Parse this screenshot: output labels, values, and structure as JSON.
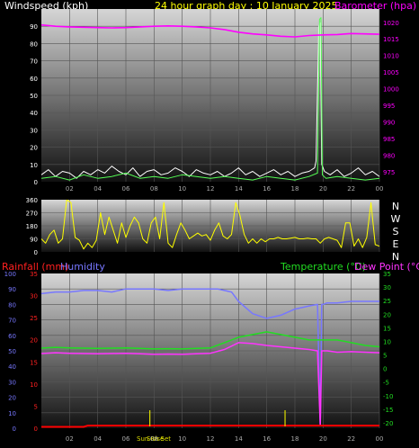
{
  "header": {
    "left_title": "Windspeed (kph)",
    "center_title": "24 hour graph day : 10 January 2025",
    "right_title": "Barometer (hpa)"
  },
  "colors": {
    "background": "#000000",
    "wind_axis": "#ffffff",
    "wind_speed": "#ffffff",
    "wind_gust": "#55ff55",
    "barometer": "#ff00ff",
    "direction": "#ffff00",
    "rain_axis": "#ff2020",
    "humidity": "#7777ff",
    "temperature": "#22dd22",
    "dew_point": "#ff33ff",
    "rain": "#ff0000",
    "sun_marker": "#dddd00",
    "axis_time": "#aaaaaa"
  },
  "chart_data": [
    {
      "id": "wind_baro",
      "type": "line",
      "title": "24 hour graph day : 10 January 2025",
      "x_ticks": [
        "02",
        "04",
        "06",
        "08",
        "10",
        "12",
        "14",
        "16",
        "18",
        "20",
        "22",
        "00"
      ],
      "xlim": [
        0,
        24
      ],
      "left_axis": {
        "label": "Windspeed (kph)",
        "ylim": [
          0,
          100
        ],
        "ticks": [
          "0",
          "10",
          "20",
          "30",
          "40",
          "50",
          "60",
          "70",
          "80",
          "90"
        ]
      },
      "right_axis": {
        "label": "Barometer (hpa)",
        "ylim": [
          972,
          1024
        ],
        "ticks": [
          "975",
          "980",
          "985",
          "990",
          "995",
          "1000",
          "1005",
          "1010",
          "1015",
          "1020"
        ]
      },
      "series": [
        {
          "key": "wind_speed",
          "axis": "left",
          "x": [
            0,
            0.5,
            1,
            1.5,
            2,
            2.5,
            3,
            3.5,
            4,
            4.5,
            5,
            5.5,
            6,
            6.5,
            7,
            7.5,
            8,
            8.5,
            9,
            9.5,
            10,
            10.5,
            11,
            11.5,
            12,
            12.5,
            13,
            13.5,
            14,
            14.5,
            15,
            15.5,
            16,
            16.5,
            17,
            17.5,
            18,
            18.5,
            19,
            19.4,
            19.5,
            19.7,
            19.8,
            19.9,
            20.1,
            20.5,
            21,
            21.5,
            22,
            22.5,
            23,
            23.5,
            24
          ],
          "y": [
            4,
            7,
            3,
            6,
            5,
            2,
            6,
            4,
            7,
            5,
            9,
            6,
            4,
            8,
            3,
            6,
            7,
            4,
            5,
            8,
            6,
            3,
            7,
            5,
            4,
            6,
            3,
            5,
            8,
            4,
            6,
            3,
            5,
            7,
            4,
            6,
            3,
            5,
            6,
            8,
            12,
            90,
            92,
            10,
            6,
            4,
            7,
            3,
            5,
            8,
            4,
            6,
            3
          ]
        },
        {
          "key": "wind_gust",
          "axis": "left",
          "x": [
            0,
            1,
            2,
            3,
            4,
            5,
            6,
            7,
            8,
            9,
            10,
            11,
            12,
            13,
            14,
            15,
            16,
            17,
            18,
            19,
            19.6,
            19.75,
            19.85,
            19.95,
            20.2,
            21,
            22,
            23,
            24
          ],
          "y": [
            2,
            3,
            1,
            4,
            2,
            3,
            5,
            2,
            3,
            2,
            4,
            3,
            2,
            3,
            2,
            1,
            3,
            2,
            1,
            3,
            5,
            94,
            95,
            4,
            2,
            3,
            2,
            1,
            2
          ]
        },
        {
          "key": "barometer",
          "axis": "right",
          "x": [
            0,
            1,
            2,
            3,
            4,
            5,
            6,
            7,
            8,
            9,
            10,
            11,
            12,
            13,
            14,
            15,
            16,
            17,
            18,
            19,
            20,
            21,
            22,
            23,
            24
          ],
          "y": [
            1019.2,
            1018.8,
            1018.6,
            1018.5,
            1018.4,
            1018.3,
            1018.4,
            1018.6,
            1018.8,
            1018.9,
            1018.8,
            1018.6,
            1018.3,
            1017.8,
            1017.0,
            1016.5,
            1016.2,
            1015.8,
            1015.6,
            1016.0,
            1016.2,
            1016.3,
            1016.6,
            1016.5,
            1016.4
          ]
        }
      ]
    },
    {
      "id": "wind_direction",
      "type": "line",
      "x_ticks": [],
      "xlim": [
        0,
        24
      ],
      "left_axis": {
        "ylim": [
          0,
          360
        ],
        "ticks": [
          "0",
          "90",
          "180",
          "270",
          "360"
        ]
      },
      "right_labels": [
        "N",
        "W",
        "S",
        "E",
        "N"
      ],
      "series": [
        {
          "key": "direction",
          "x": [
            0,
            0.3,
            0.6,
            0.9,
            1.2,
            1.5,
            1.8,
            2.1,
            2.4,
            2.7,
            3.0,
            3.3,
            3.6,
            3.9,
            4.2,
            4.5,
            4.8,
            5.1,
            5.4,
            5.7,
            6.0,
            6.3,
            6.6,
            6.9,
            7.2,
            7.5,
            7.8,
            8.1,
            8.4,
            8.7,
            9.0,
            9.3,
            9.6,
            9.9,
            10.2,
            10.5,
            10.8,
            11.1,
            11.4,
            11.7,
            12.0,
            12.3,
            12.6,
            12.9,
            13.2,
            13.5,
            13.8,
            14.1,
            14.4,
            14.7,
            15.0,
            15.3,
            15.6,
            15.9,
            16.2,
            16.5,
            16.8,
            17.1,
            17.4,
            17.7,
            18.0,
            18.3,
            18.6,
            18.9,
            19.2,
            19.5,
            19.8,
            20.1,
            20.4,
            20.7,
            21.0,
            21.3,
            21.6,
            21.9,
            22.2,
            22.5,
            22.8,
            23.1,
            23.4,
            23.7,
            24.0
          ],
          "y": [
            90,
            60,
            120,
            150,
            60,
            90,
            360,
            340,
            100,
            80,
            20,
            60,
            30,
            80,
            270,
            120,
            240,
            150,
            60,
            200,
            100,
            180,
            240,
            200,
            90,
            60,
            200,
            240,
            90,
            340,
            60,
            30,
            120,
            200,
            150,
            90,
            110,
            130,
            110,
            120,
            80,
            150,
            200,
            110,
            90,
            120,
            340,
            250,
            120,
            60,
            90,
            60,
            90,
            70,
            90,
            90,
            100,
            90,
            90,
            95,
            100,
            90,
            90,
            95,
            90,
            90,
            60,
            90,
            100,
            90,
            80,
            30,
            200,
            200,
            40,
            90,
            30,
            100,
            340,
            50,
            40
          ]
        }
      ]
    },
    {
      "id": "temp_rain_hum",
      "type": "line",
      "x_ticks": [
        "02",
        "04",
        "06",
        "08",
        "10",
        "12",
        "14",
        "16",
        "18",
        "20",
        "22",
        "00"
      ],
      "xlim": [
        0,
        24
      ],
      "humidity_axis": {
        "label": "Humidity",
        "ylim": [
          0,
          100
        ],
        "ticks": [
          "0",
          "10",
          "20",
          "30",
          "40",
          "50",
          "60",
          "70",
          "80",
          "90",
          "100"
        ]
      },
      "rain_axis": {
        "label": "Rainfall (mm)",
        "ylim": [
          0,
          35
        ],
        "ticks": [
          "0",
          "5",
          "10",
          "15",
          "20",
          "25",
          "30",
          "35"
        ]
      },
      "temp_axis": {
        "label": "Temperature (°C)",
        "ylim": [
          -22,
          35
        ],
        "ticks": [
          "-20",
          "-15",
          "-10",
          "-5",
          "0",
          "5",
          "10",
          "15",
          "20",
          "25",
          "30",
          "35"
        ]
      },
      "dew_label": "Dew Point (°C)",
      "sun_markers": [
        {
          "label": "Sun Rise",
          "x": 7.7
        },
        {
          "label": "Sun Set",
          "x": 17.3
        }
      ],
      "series": [
        {
          "key": "humidity",
          "axis": "humidity",
          "x": [
            0,
            1,
            2,
            3,
            4,
            5,
            6,
            7,
            8,
            9,
            10,
            11,
            12,
            12.5,
            13,
            13.5,
            14,
            15,
            16,
            17,
            18,
            19,
            19.6,
            19.8,
            19.9,
            20.0,
            20.3,
            21,
            22,
            23,
            24
          ],
          "y": [
            87,
            88,
            88,
            89,
            89,
            88,
            90,
            90,
            90,
            89,
            90,
            90,
            90,
            90,
            89,
            88,
            82,
            74,
            71,
            73,
            77,
            79,
            80,
            2,
            80,
            80,
            81,
            81,
            82,
            82,
            82
          ]
        },
        {
          "key": "temperature",
          "axis": "temp",
          "x": [
            0,
            1,
            2,
            3,
            4,
            5,
            6,
            7,
            8,
            9,
            10,
            11,
            12,
            13,
            14,
            15,
            16,
            17,
            18,
            19,
            20,
            21,
            22,
            23,
            24
          ],
          "y": [
            7.5,
            7.8,
            7.6,
            7.5,
            7.4,
            7.5,
            7.6,
            7.4,
            7.2,
            7.3,
            7.2,
            7.4,
            7.6,
            9.5,
            11.5,
            12.5,
            13.5,
            12.5,
            11.5,
            10.5,
            10.5,
            10.5,
            9.5,
            8.5,
            8.0
          ]
        },
        {
          "key": "dew_point",
          "axis": "temp",
          "x": [
            0,
            1,
            2,
            3,
            4,
            5,
            6,
            7,
            8,
            9,
            10,
            11,
            12,
            13,
            14,
            15,
            16,
            17,
            18,
            19,
            19.6,
            19.8,
            19.9,
            20.0,
            20.3,
            21,
            22,
            23,
            24
          ],
          "y": [
            5.5,
            5.8,
            5.6,
            5.5,
            5.4,
            5.5,
            5.6,
            5.4,
            5.2,
            5.3,
            5.2,
            5.4,
            5.6,
            7.0,
            9.5,
            9.2,
            8.5,
            8.0,
            7.5,
            7.0,
            6.5,
            -21,
            6.5,
            6.5,
            6.5,
            6.0,
            6.2,
            6.0,
            5.8
          ]
        },
        {
          "key": "rain",
          "axis": "rain",
          "x": [
            0,
            3,
            3.3,
            6,
            12,
            18,
            24
          ],
          "y": [
            0.3,
            0.3,
            0.6,
            0.6,
            0.6,
            0.6,
            0.6
          ]
        }
      ]
    }
  ]
}
